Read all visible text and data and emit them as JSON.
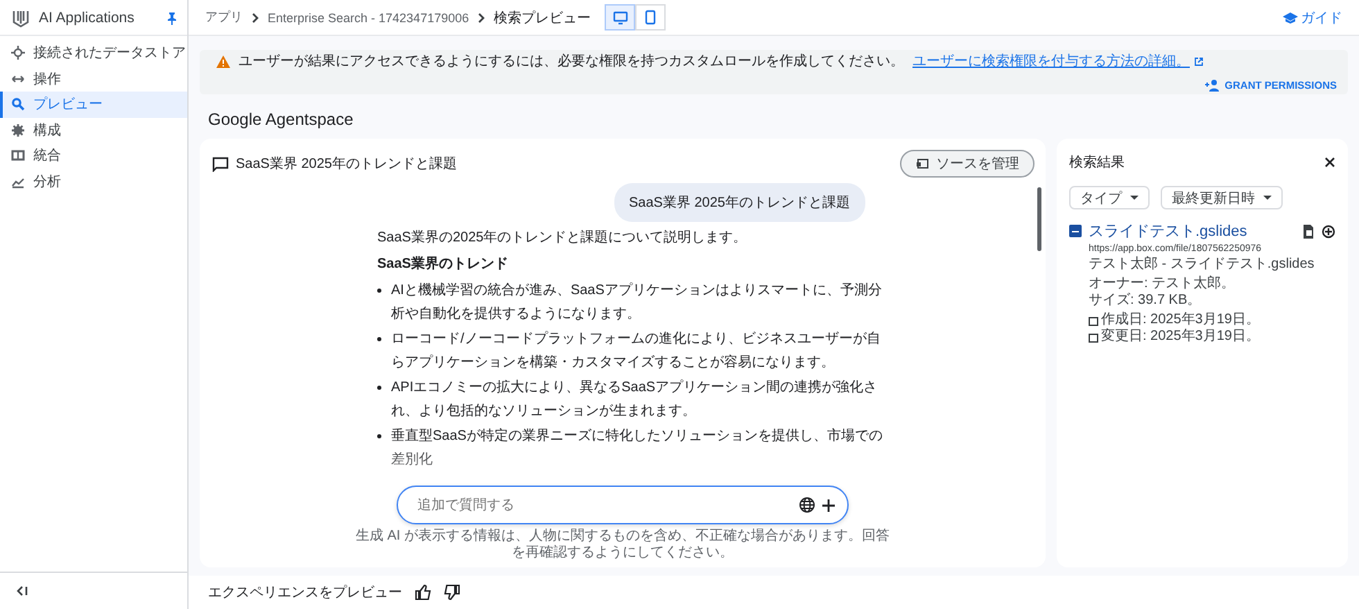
{
  "app": {
    "title": "AI Applications"
  },
  "sidebar": {
    "items": [
      {
        "kind": "datastore",
        "label": "接続されたデータストア",
        "selected": false
      },
      {
        "kind": "actions",
        "label": "操作",
        "selected": false
      },
      {
        "kind": "preview",
        "label": "プレビュー",
        "selected": true
      },
      {
        "kind": "config",
        "label": "構成",
        "selected": false
      },
      {
        "kind": "integration",
        "label": "統合",
        "selected": false
      },
      {
        "kind": "analytics",
        "label": "分析",
        "selected": false
      }
    ]
  },
  "breadcrumb": [
    "アプリ",
    "Enterprise Search - 1742347179006",
    "検索プレビュー"
  ],
  "view_toggle": [
    {
      "kind": "desktop",
      "selected": true
    },
    {
      "kind": "mobile",
      "selected": false
    }
  ],
  "guide_link": "ガイド",
  "banner": {
    "message": "ユーザーが結果にアクセスできるようにするには、必要な権限を持つカスタムロールを作成してください。",
    "link": "ユーザーに検索権限を付与する方法の詳細。",
    "action": "GRANT PERMISSIONS"
  },
  "page_title": "Google Agentspace",
  "chat": {
    "title": "SaaS業界 2025年のトレンドと課題",
    "manage_sources": "ソースを管理",
    "user_message": "SaaS業界 2025年のトレンドと課題",
    "answer": {
      "intro": "SaaS業界の2025年のトレンドと課題について説明します。",
      "heading": "SaaS業界のトレンド",
      "bullets": [
        "AIと機械学習の統合が進み、SaaSアプリケーションはよりスマートに、予測分析や自動化を提供するようになります。",
        "ローコード/ノーコードプラットフォームの進化により、ビジネスユーザーが自らアプリケーションを構築・カスタマイズすることが容易になります。",
        "APIエコノミーの拡大により、異なるSaaSアプリケーション間の連携が強化され、より包括的なソリューションが生まれます。",
        "垂直型SaaSが特定の業界ニーズに特化したソリューションを提供し、市場での差別化"
      ]
    },
    "input": {
      "placeholder": "追加で質問する"
    },
    "disclaimer": "生成 AI が表示する情報は、人物に関するものを含め、不正確な場合があります。回答を再確認するようにしてください。"
  },
  "results": {
    "title": "検索結果",
    "filters": [
      "タイプ",
      "最終更新日時"
    ],
    "items": [
      {
        "title": "スライドテスト.gslides",
        "url": "https://app.box.com/file/1807562250976",
        "path": "テスト太郎 - スライドテスト.gslides",
        "owner": "オーナー: テスト太郎。",
        "size": "サイズ: 39.7 KB。",
        "created": "作成日: 2025年3月19日。",
        "modified": "変更日: 2025年3月19日。"
      }
    ]
  },
  "footer": {
    "label": "エクスペリエンスをプレビュー"
  }
}
